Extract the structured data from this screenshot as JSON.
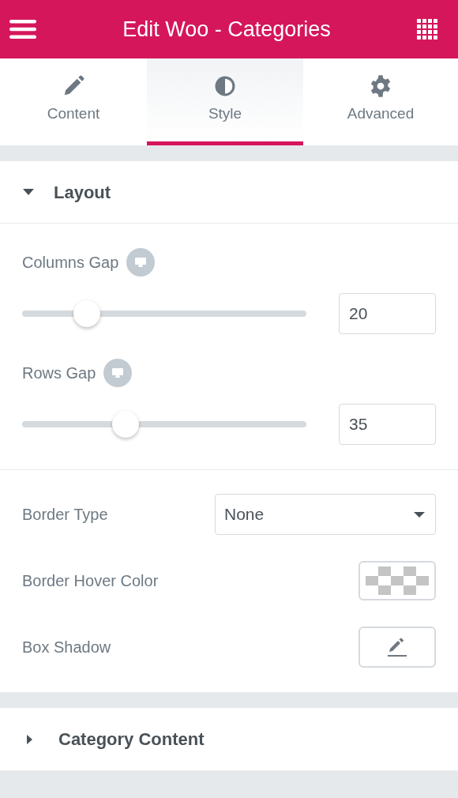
{
  "header": {
    "title": "Edit Woo - Categories"
  },
  "tabs": [
    {
      "label": "Content",
      "selected": false
    },
    {
      "label": "Style",
      "selected": true
    },
    {
      "label": "Advanced",
      "selected": false
    }
  ],
  "sections": [
    {
      "title": "Layout",
      "expanded": true,
      "groups": [
        [
          {
            "kind": "slider",
            "label": "Columns Gap",
            "level": 0.2,
            "value": "20"
          },
          {
            "kind": "slider",
            "label": "Rows Gap",
            "level": 0.35,
            "value": "35"
          }
        ],
        [
          {
            "kind": "select",
            "label": "Border Type",
            "value": "None"
          },
          {
            "kind": "color",
            "label": "Border Hover Color"
          },
          {
            "kind": "edit",
            "label": "Box Shadow"
          }
        ]
      ]
    },
    {
      "title": "Category Content",
      "expanded": false
    }
  ]
}
